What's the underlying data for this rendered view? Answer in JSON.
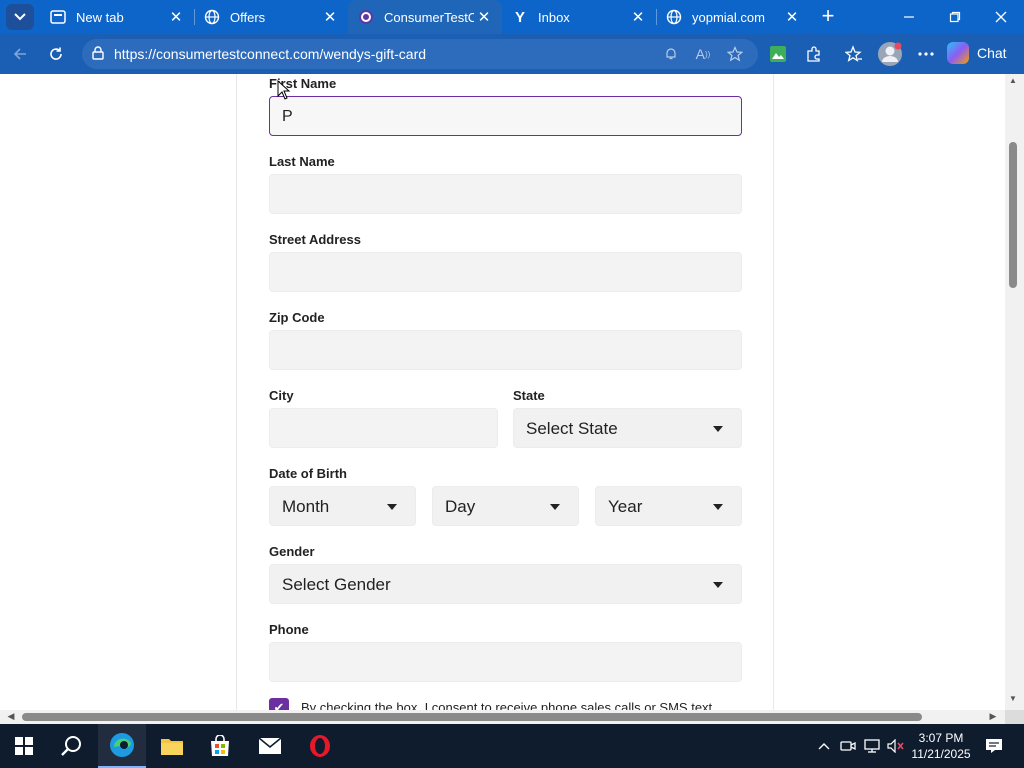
{
  "browser": {
    "tabs": [
      {
        "title": "New tab",
        "icon": "edge-newtab-icon",
        "active": false
      },
      {
        "title": "Offers",
        "icon": "globe-icon",
        "active": false
      },
      {
        "title": "ConsumerTestCor",
        "icon": "consumertest-icon",
        "active": true
      },
      {
        "title": "Inbox",
        "icon": "yahoo-icon",
        "active": false
      },
      {
        "title": "yopmial.com",
        "icon": "globe-icon",
        "active": false
      }
    ],
    "url": "https://consumertestconnect.com/wendys-gift-card",
    "chat_label": "Chat"
  },
  "form": {
    "first_name": {
      "label": "First Name",
      "value": "P"
    },
    "last_name": {
      "label": "Last Name",
      "value": ""
    },
    "street_address": {
      "label": "Street Address",
      "value": ""
    },
    "zip_code": {
      "label": "Zip Code",
      "value": ""
    },
    "city": {
      "label": "City",
      "value": ""
    },
    "state": {
      "label": "State",
      "selected": "Select State"
    },
    "dob": {
      "label": "Date of Birth",
      "month": "Month",
      "day": "Day",
      "year": "Year"
    },
    "gender": {
      "label": "Gender",
      "selected": "Select Gender"
    },
    "phone": {
      "label": "Phone",
      "value": ""
    },
    "consent": {
      "checked": true,
      "text": "By checking the box, I consent to receive phone sales calls or SMS text"
    }
  },
  "taskbar": {
    "time": "3:07 PM",
    "date": "11/21/2025"
  },
  "colors": {
    "accent": "#6b2fa0",
    "tabstrip": "#0d65c9"
  }
}
